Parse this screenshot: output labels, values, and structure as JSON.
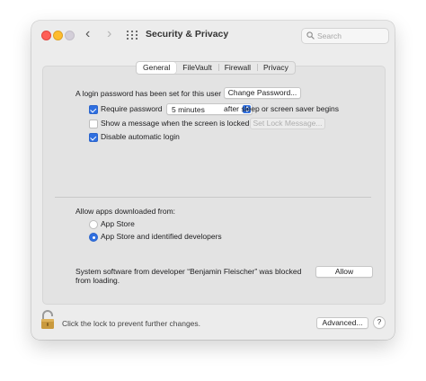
{
  "window": {
    "title": "Security & Privacy"
  },
  "search": {
    "placeholder": "Search"
  },
  "tabs": [
    {
      "label": "General",
      "active": true
    },
    {
      "label": "FileVault"
    },
    {
      "label": "Firewall"
    },
    {
      "label": "Privacy"
    }
  ],
  "general": {
    "password_text": "A login password has been set for this user",
    "change_password_label": "Change Password...",
    "require_password_label": "Require password",
    "require_password_checked": true,
    "require_delay_value": "5 minutes",
    "after_sleep_text": "after sleep or screen saver begins",
    "show_message_label": "Show a message when the screen is locked",
    "show_message_checked": false,
    "set_lock_message_label": "Set Lock Message...",
    "disable_auto_login_label": "Disable automatic login",
    "disable_auto_login_checked": true
  },
  "downloads": {
    "heading": "Allow apps downloaded from:",
    "options": [
      {
        "label": "App Store",
        "selected": false
      },
      {
        "label": "App Store and identified developers",
        "selected": true
      }
    ]
  },
  "blocked": {
    "line1": "System software from developer “Benjamin Fleischer” was blocked",
    "line2": "from loading.",
    "allow_label": "Allow"
  },
  "footer": {
    "lock_text": "Click the lock to prevent further changes.",
    "advanced_label": "Advanced...",
    "help_label": "?"
  },
  "colors": {
    "accent": "#2f6fe0",
    "close": "#fe5f57",
    "minimize": "#febc2e",
    "zoom": "#d4cfd9"
  }
}
